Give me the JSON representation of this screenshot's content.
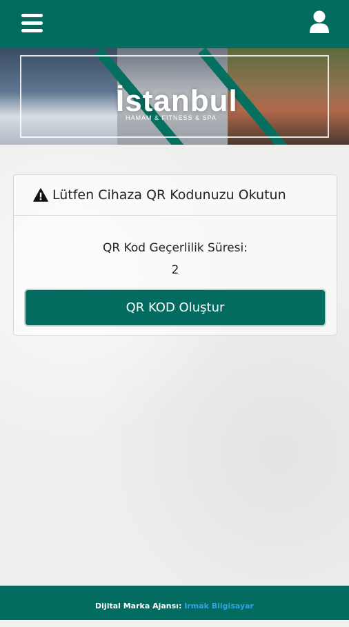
{
  "header": {
    "menu_icon": "hamburger-menu-icon",
    "user_icon": "user-account-icon",
    "bar_color": "#046b60"
  },
  "banner": {
    "logo_text": "İstanbul",
    "tagline": "HAMAM & FITNESS & SPA"
  },
  "card": {
    "warning_icon": "warning-triangle-icon",
    "title": "Lütfen Cihaza QR Kodunuzu Okutun",
    "validity_label": "QR Kod Geçerlilik Süresi:",
    "validity_value": "2",
    "button_label": "QR KOD Oluştur"
  },
  "footer": {
    "prefix": "Dijital Marka Ajansı:",
    "link_text": "Irmak Bilgisayar",
    "link_color": "#2ea3e8"
  }
}
